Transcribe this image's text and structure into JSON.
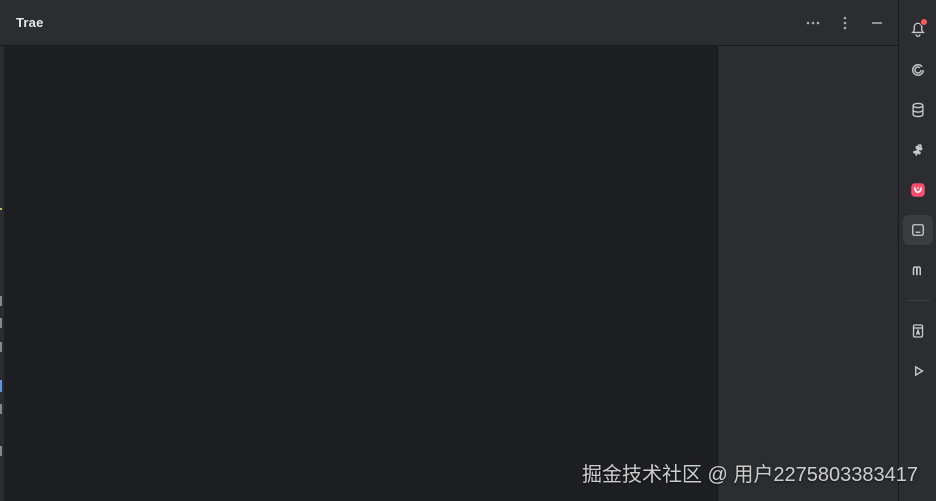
{
  "header": {
    "title": "Trae",
    "actions": [
      {
        "name": "more-horizontal",
        "icon": "more-horizontal-icon"
      },
      {
        "name": "more-vertical",
        "icon": "more-vertical-icon"
      },
      {
        "name": "minimize",
        "icon": "minimize-icon"
      }
    ]
  },
  "right_toolbar": {
    "items": [
      {
        "id": "notifications",
        "icon": "bell-icon",
        "selected": false,
        "has_badge": true
      },
      {
        "id": "ai",
        "icon": "swirl-icon",
        "selected": false
      },
      {
        "id": "database",
        "icon": "database-icon",
        "selected": false
      },
      {
        "id": "tool",
        "icon": "monkey-icon",
        "selected": false
      },
      {
        "id": "pink-app",
        "icon": "pink-app-icon",
        "selected": false
      },
      {
        "id": "panel",
        "icon": "panel-icon",
        "selected": true
      },
      {
        "id": "m-tool",
        "icon": "m-icon",
        "selected": false
      },
      {
        "id": "reader",
        "icon": "reader-icon",
        "selected": false
      },
      {
        "id": "run",
        "icon": "play-icon",
        "selected": false
      }
    ]
  },
  "watermark": {
    "text": "掘金技术社区 @ 用户2275803383417"
  },
  "colors": {
    "main_bg": "#1e1f22",
    "panel_bg": "#2b2d30",
    "notification": "#ff5a5a",
    "brand_pink": "#ff4d6d"
  }
}
